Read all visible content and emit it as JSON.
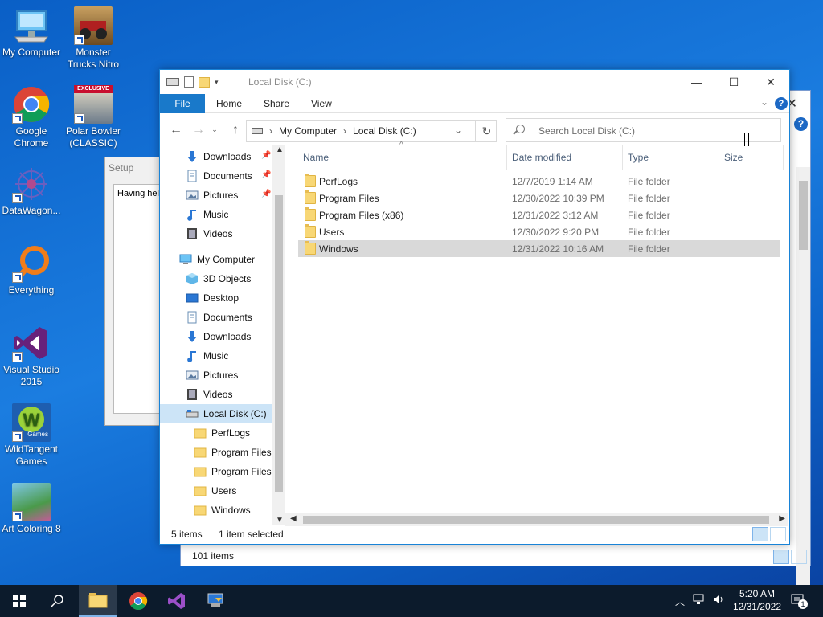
{
  "desktop": {
    "icons": [
      {
        "label": "My Computer"
      },
      {
        "label": "Monster Trucks Nitro"
      },
      {
        "label": "Google Chrome"
      },
      {
        "label": "Polar Bowler (CLASSIC)"
      },
      {
        "label": "DataWagon..."
      },
      {
        "label": "Everything"
      },
      {
        "label": "Visual Studio 2015"
      },
      {
        "label": "WildTangent Games"
      },
      {
        "label": "Art Coloring 8"
      }
    ],
    "exclusive_badge": "EXCLUSIVE",
    "wildtangent_badge": "Games"
  },
  "setup_window": {
    "title": "Setup",
    "body_text": "Having help"
  },
  "back_window": {
    "status": "101 items"
  },
  "explorer": {
    "title": "Local Disk (C:)",
    "ribbon": {
      "file": "File",
      "home": "Home",
      "share": "Share",
      "view": "View"
    },
    "address": {
      "crumb1": "My Computer",
      "crumb2": "Local Disk (C:)"
    },
    "search_placeholder": "Search Local Disk (C:)",
    "nav": {
      "quick": [
        {
          "label": "Downloads"
        },
        {
          "label": "Documents"
        },
        {
          "label": "Pictures"
        },
        {
          "label": "Music"
        },
        {
          "label": "Videos"
        }
      ],
      "my_computer": "My Computer",
      "pc_items": [
        {
          "label": "3D Objects"
        },
        {
          "label": "Desktop"
        },
        {
          "label": "Documents"
        },
        {
          "label": "Downloads"
        },
        {
          "label": "Music"
        },
        {
          "label": "Pictures"
        },
        {
          "label": "Videos"
        },
        {
          "label": "Local Disk (C:)"
        }
      ],
      "folders": [
        {
          "label": "PerfLogs"
        },
        {
          "label": "Program Files"
        },
        {
          "label": "Program Files ("
        },
        {
          "label": "Users"
        },
        {
          "label": "Windows"
        }
      ]
    },
    "columns": {
      "name": "Name",
      "date": "Date modified",
      "type": "Type",
      "size": "Size"
    },
    "files": [
      {
        "name": "PerfLogs",
        "date": "12/7/2019 1:14 AM",
        "type": "File folder"
      },
      {
        "name": "Program Files",
        "date": "12/30/2022 10:39 PM",
        "type": "File folder"
      },
      {
        "name": "Program Files (x86)",
        "date": "12/31/2022 3:12 AM",
        "type": "File folder"
      },
      {
        "name": "Users",
        "date": "12/30/2022 9:20 PM",
        "type": "File folder"
      },
      {
        "name": "Windows",
        "date": "12/31/2022 10:16 AM",
        "type": "File folder"
      }
    ],
    "status": {
      "count": "5 items",
      "selected": "1 item selected"
    }
  },
  "taskbar": {
    "time": "5:20 AM",
    "date": "12/31/2022",
    "notification_count": "1"
  },
  "colors": {
    "accent": "#1979ca",
    "selection": "#cce4f7",
    "folder": "#f8d775"
  }
}
